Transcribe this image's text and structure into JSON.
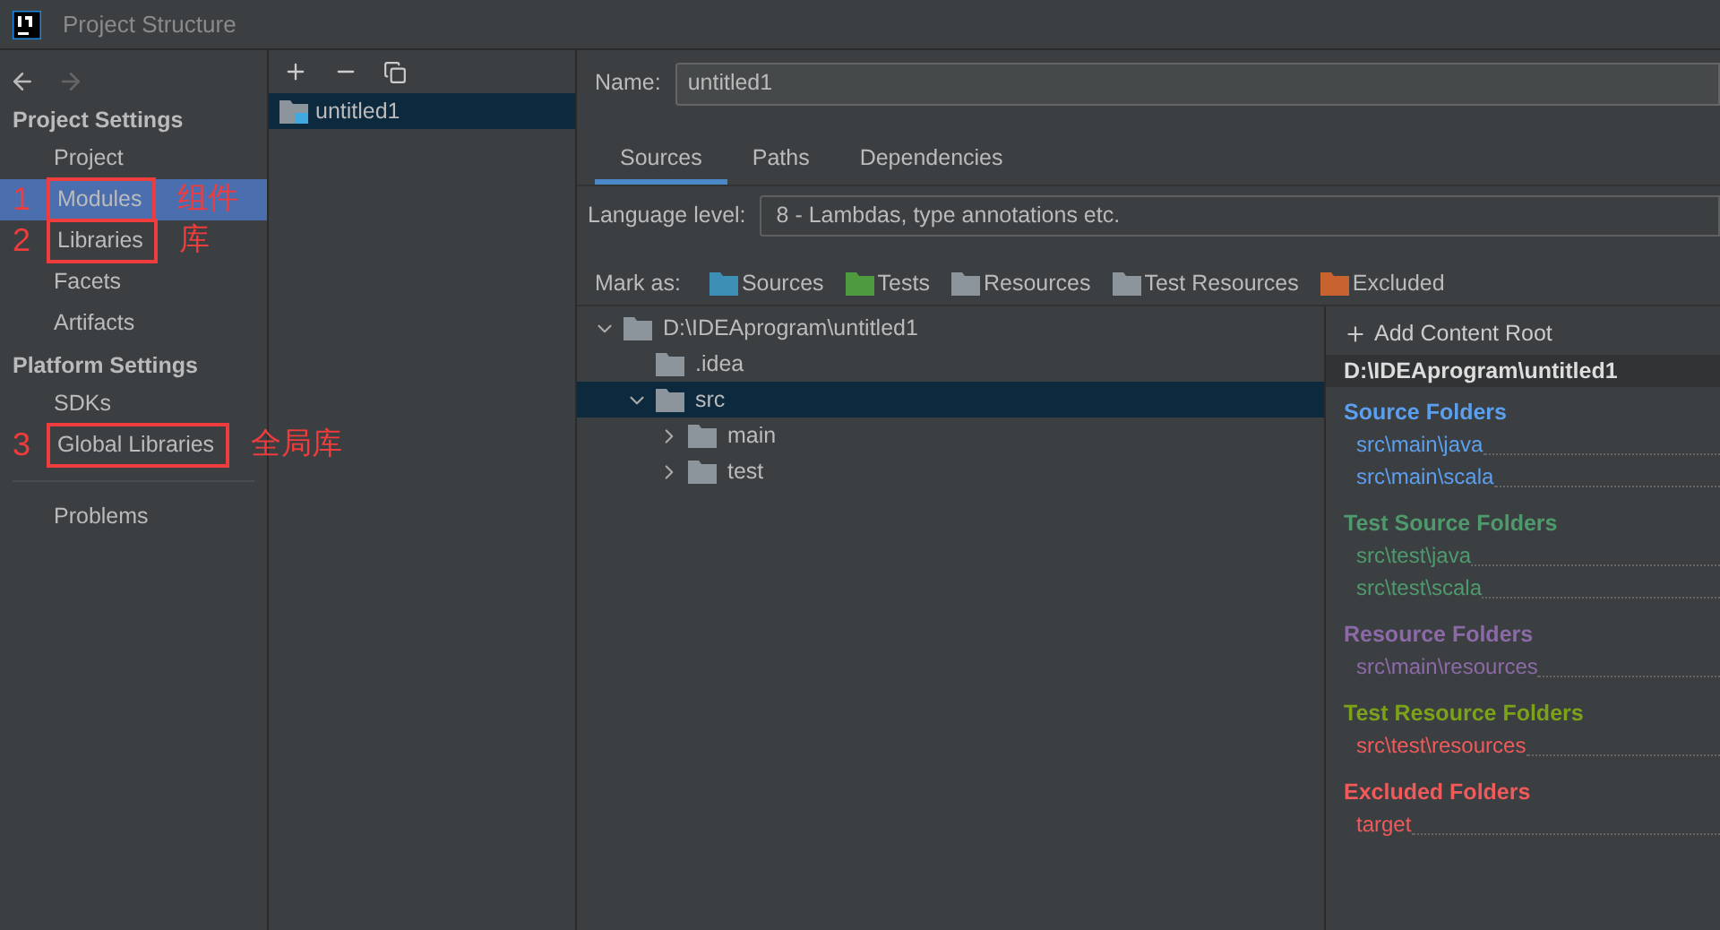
{
  "window": {
    "title": "Project Structure"
  },
  "sidebar": {
    "groups": [
      {
        "title": "Project Settings",
        "items": [
          {
            "label": "Project",
            "selected": false
          },
          {
            "label": "Modules",
            "selected": true,
            "annotation": {
              "number": "1",
              "note": "组件"
            }
          },
          {
            "label": "Libraries",
            "selected": false,
            "annotation": {
              "number": "2",
              "note": "库"
            }
          },
          {
            "label": "Facets",
            "selected": false
          },
          {
            "label": "Artifacts",
            "selected": false
          }
        ]
      },
      {
        "title": "Platform Settings",
        "items": [
          {
            "label": "SDKs",
            "selected": false
          },
          {
            "label": "Global Libraries",
            "selected": false,
            "annotation": {
              "number": "3",
              "note": "全局库"
            }
          }
        ]
      }
    ],
    "footer_items": [
      {
        "label": "Problems",
        "selected": false
      }
    ]
  },
  "modules": [
    {
      "label": "untitled1",
      "selected": true
    }
  ],
  "name_field": {
    "label": "Name:",
    "value": "untitled1"
  },
  "tabs": [
    {
      "label": "Sources",
      "selected": true
    },
    {
      "label": "Paths",
      "selected": false
    },
    {
      "label": "Dependencies",
      "selected": false
    }
  ],
  "language_level": {
    "label": "Language level:",
    "value": "8 - Lambdas, type annotations etc."
  },
  "mark_as": {
    "label": "Mark as:",
    "options": [
      {
        "label": "Sources",
        "color": "#3d8fb5"
      },
      {
        "label": "Tests",
        "color": "#4e9a3f"
      },
      {
        "label": "Resources",
        "color": "#8c959c"
      },
      {
        "label": "Test Resources",
        "color": "#8c959c"
      },
      {
        "label": "Excluded",
        "color": "#c8632f"
      }
    ]
  },
  "tree": [
    {
      "label": "D:\\IDEAprogram\\untitled1",
      "expanded": true,
      "selected": false,
      "children": [
        {
          "label": ".idea",
          "selected": false
        },
        {
          "label": "src",
          "expanded": true,
          "selected": true,
          "children": [
            {
              "label": "main",
              "expanded": false,
              "selected": false
            },
            {
              "label": "test",
              "expanded": false,
              "selected": false
            }
          ]
        }
      ]
    }
  ],
  "content_root": {
    "add_label": "Add Content Root",
    "root": "D:\\IDEAprogram\\untitled1",
    "sections": [
      {
        "title": "Source Folders",
        "color": "#5c9fef",
        "folders": [
          {
            "path": "src\\main\\java",
            "color": "#5c9fef"
          },
          {
            "path": "src\\main\\scala",
            "color": "#5c9fef"
          }
        ]
      },
      {
        "title": "Test Source Folders",
        "color": "#4f9a6c",
        "folders": [
          {
            "path": "src\\test\\java",
            "color": "#4f9a6c"
          },
          {
            "path": "src\\test\\scala",
            "color": "#4f9a6c"
          }
        ]
      },
      {
        "title": "Resource Folders",
        "color": "#8c6aa8",
        "folders": [
          {
            "path": "src\\main\\resources",
            "color": "#8c6aa8"
          }
        ]
      },
      {
        "title": "Test Resource Folders",
        "color": "#7ca21a",
        "folders": [
          {
            "path": "src\\test\\resources",
            "color": "#f05a5a"
          }
        ]
      },
      {
        "title": "Excluded Folders",
        "color": "#f05a5a",
        "folders": [
          {
            "path": "target",
            "color": "#f05a5a"
          }
        ]
      }
    ]
  }
}
